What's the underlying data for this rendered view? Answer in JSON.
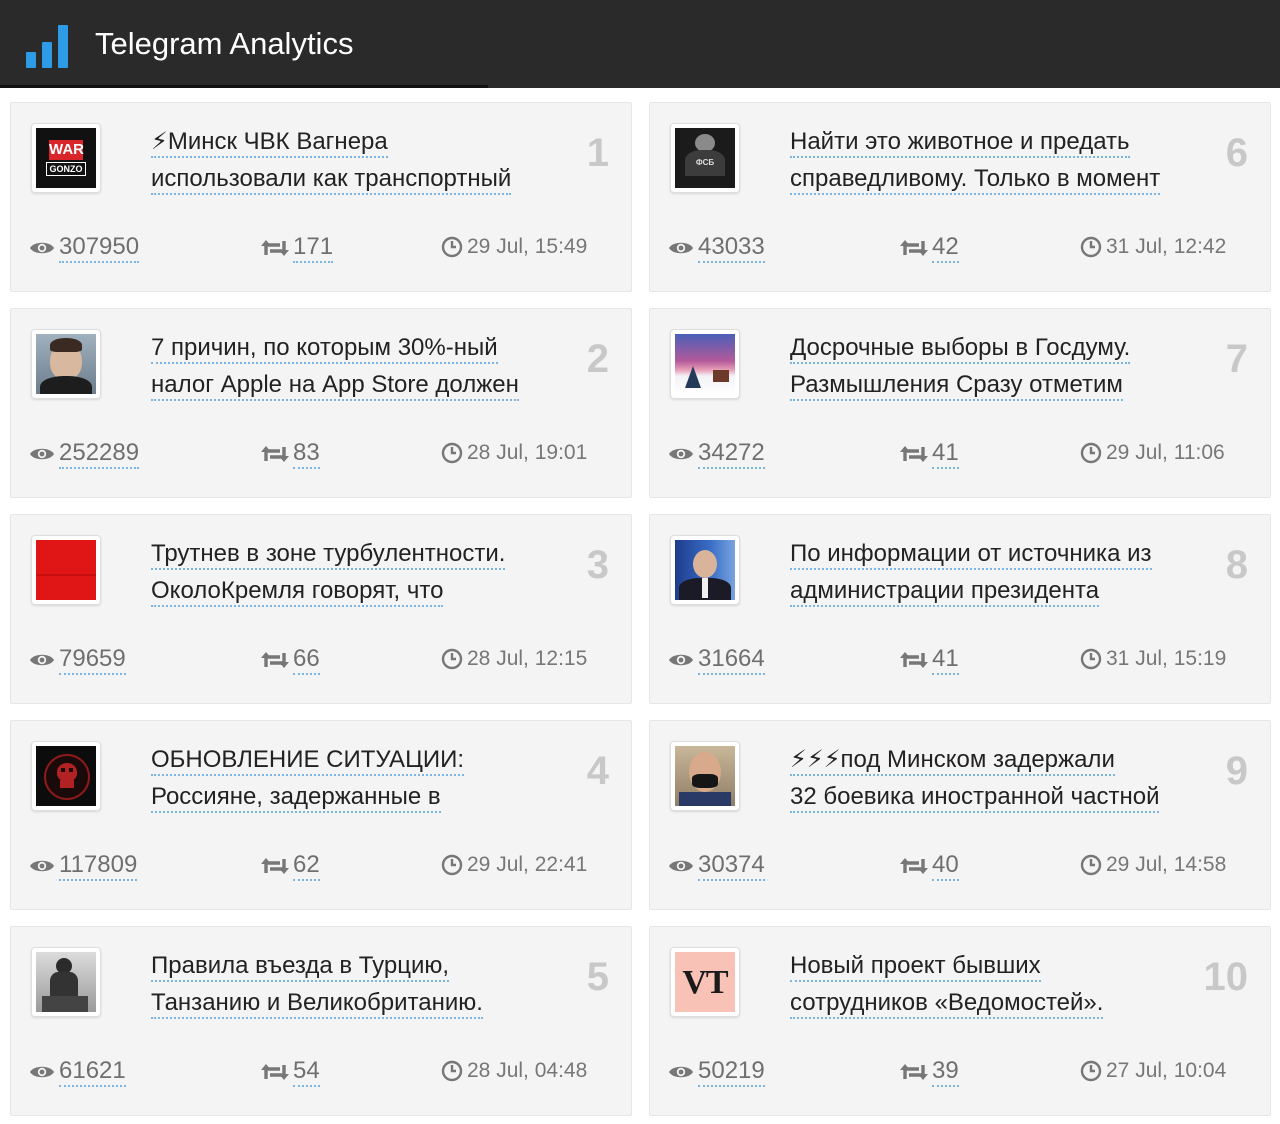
{
  "header": {
    "title": "Telegram Analytics",
    "accent": "#2e9be6"
  },
  "posts": [
    {
      "rank": "1",
      "line1": "⚡Минск ЧВК Вагнера",
      "line2": "использовали как транспортный",
      "views": "307950",
      "shares": "171",
      "time": "29 Jul, 15:49",
      "avatar": "war-gonzo-logo"
    },
    {
      "rank": "2",
      "line1": "7 причин, по которым 30%-ный",
      "line2": "налог Apple на App Store должен",
      "views": "252289",
      "shares": "83",
      "time": "28 Jul, 19:01",
      "avatar": "man-portrait"
    },
    {
      "rank": "3",
      "line1": "Трутнев в зоне турбулентности.",
      "line2": "ОколоКремля говорят, что",
      "views": "79659",
      "shares": "66",
      "time": "28 Jul, 12:15",
      "avatar": "red-square"
    },
    {
      "rank": "4",
      "line1": "ОБНОВЛЕНИЕ СИТУАЦИИ:",
      "line2": "Россияне, задержанные в",
      "views": "117809",
      "shares": "62",
      "time": "29 Jul, 22:41",
      "avatar": "skull-emblem"
    },
    {
      "rank": "5",
      "line1": "Правила въезда в Турцию,",
      "line2": "Танзанию и Великобританию.",
      "views": "61621",
      "shares": "54",
      "time": "28 Jul, 04:48",
      "avatar": "statue-photo"
    },
    {
      "rank": "6",
      "line1": "Найти это животное и предать",
      "line2": "справедливому. Только в момент",
      "views": "43033",
      "shares": "42",
      "time": "31 Jul, 12:42",
      "avatar": "fsb-figure"
    },
    {
      "rank": "7",
      "line1": "Досрочные выборы в Госдуму.",
      "line2": "Размышления Сразу отметим",
      "views": "34272",
      "shares": "41",
      "time": "29 Jul, 11:06",
      "avatar": "winter-landscape"
    },
    {
      "rank": "8",
      "line1": "По информации от источника из",
      "line2": "администрации президента",
      "views": "31664",
      "shares": "41",
      "time": "31 Jul, 15:19",
      "avatar": "man-in-suit"
    },
    {
      "rank": "9",
      "line1": "⚡⚡⚡под Минском задержали",
      "line2": "32 боевика иностранной частной",
      "views": "30374",
      "shares": "40",
      "time": "29 Jul, 14:58",
      "avatar": "man-with-mask"
    },
    {
      "rank": "10",
      "line1": "Новый проект бывших",
      "line2": "сотрудников «Ведомостей».",
      "views": "50219",
      "shares": "39",
      "time": "27 Jul, 10:04",
      "avatar": "vt-logo",
      "avatar_text": "VT"
    }
  ],
  "avatar_texts": {
    "war": "WAR",
    "gonzo": "GONZO",
    "fsb": "ФСБ"
  }
}
